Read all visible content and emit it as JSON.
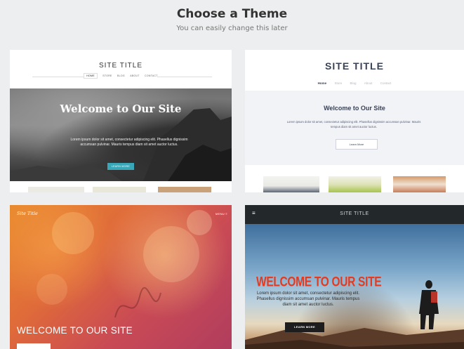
{
  "header": {
    "title": "Choose a Theme",
    "subtitle": "You can easily change this later"
  },
  "themes": [
    {
      "site_title": "SITE TITLE",
      "nav": [
        "HOME",
        "STORE",
        "BLOG",
        "ABOUT",
        "CONTACT"
      ],
      "hero_heading": "Welcome to Our Site",
      "hero_text": "Lorem ipsum dolor sit amet, consectetur adipiscing elit. Phasellus dignissim accumsan pulvinar. Mauris tempus diam sit amet auctor luctus.",
      "button_label": "LEARN MORE",
      "accent": "#3aa7b8"
    },
    {
      "site_title": "SITE TITLE",
      "nav": [
        "Home",
        "Store",
        "Blog",
        "About",
        "Contact"
      ],
      "hero_heading": "Welcome to Our Site",
      "hero_text": "Lorem ipsum dolor sit amet, consectetur adipiscing elit. Phasellus dignissim accumsan pulvinar. Mauris tempus diam sit amet auctor luctus.",
      "button_label": "Learn More",
      "accent": "#3a4256"
    },
    {
      "site_title": "Site Title",
      "menu_label": "MENU ≡",
      "hero_heading": "WELCOME TO OUR SITE",
      "accent": "#df6a3a"
    },
    {
      "site_title": "SITE TITLE",
      "menu_icon": "≡",
      "hero_heading": "WELCOME TO OUR SITE",
      "hero_text": "Lorem ipsum dolor sit amet, consectetur adipiscing elit. Phasellus dignissim accumsan pulvinar. Mauris tempus diam sit amet auctor luctus.",
      "button_label": "LEARN MORE",
      "accent": "#e23b21"
    }
  ]
}
